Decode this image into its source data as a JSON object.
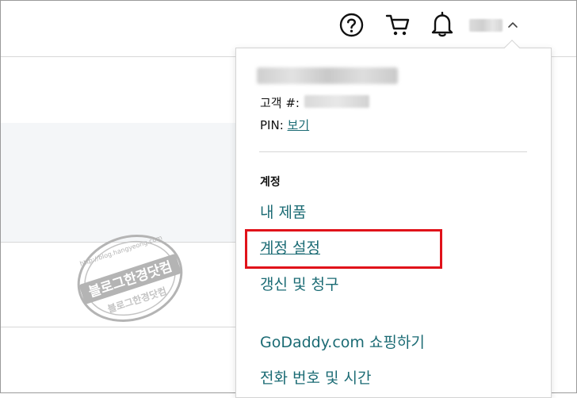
{
  "header": {
    "icons": [
      "help-icon",
      "cart-icon",
      "bell-icon",
      "chevron-up-icon"
    ]
  },
  "dropdown": {
    "customer_label": "고객 #:",
    "pin_label": "PIN:",
    "pin_link": "보기",
    "section_heading": "계정",
    "items": [
      {
        "label": "내 제품"
      },
      {
        "label": "계정 설정",
        "highlighted": true
      },
      {
        "label": "갱신 및 청구"
      },
      {
        "label": "GoDaddy.com 쇼핑하기"
      },
      {
        "label": "전화 번호 및 시간"
      }
    ]
  },
  "watermark": {
    "url": "http://blog.hangyeong.com",
    "main_text": "블로그한경닷컴",
    "colors": {
      "ink": "#b4b4b4"
    }
  },
  "colors": {
    "link": "#1b6b74",
    "highlight": "#e0121a",
    "gray_band": "#f4f6f8"
  }
}
